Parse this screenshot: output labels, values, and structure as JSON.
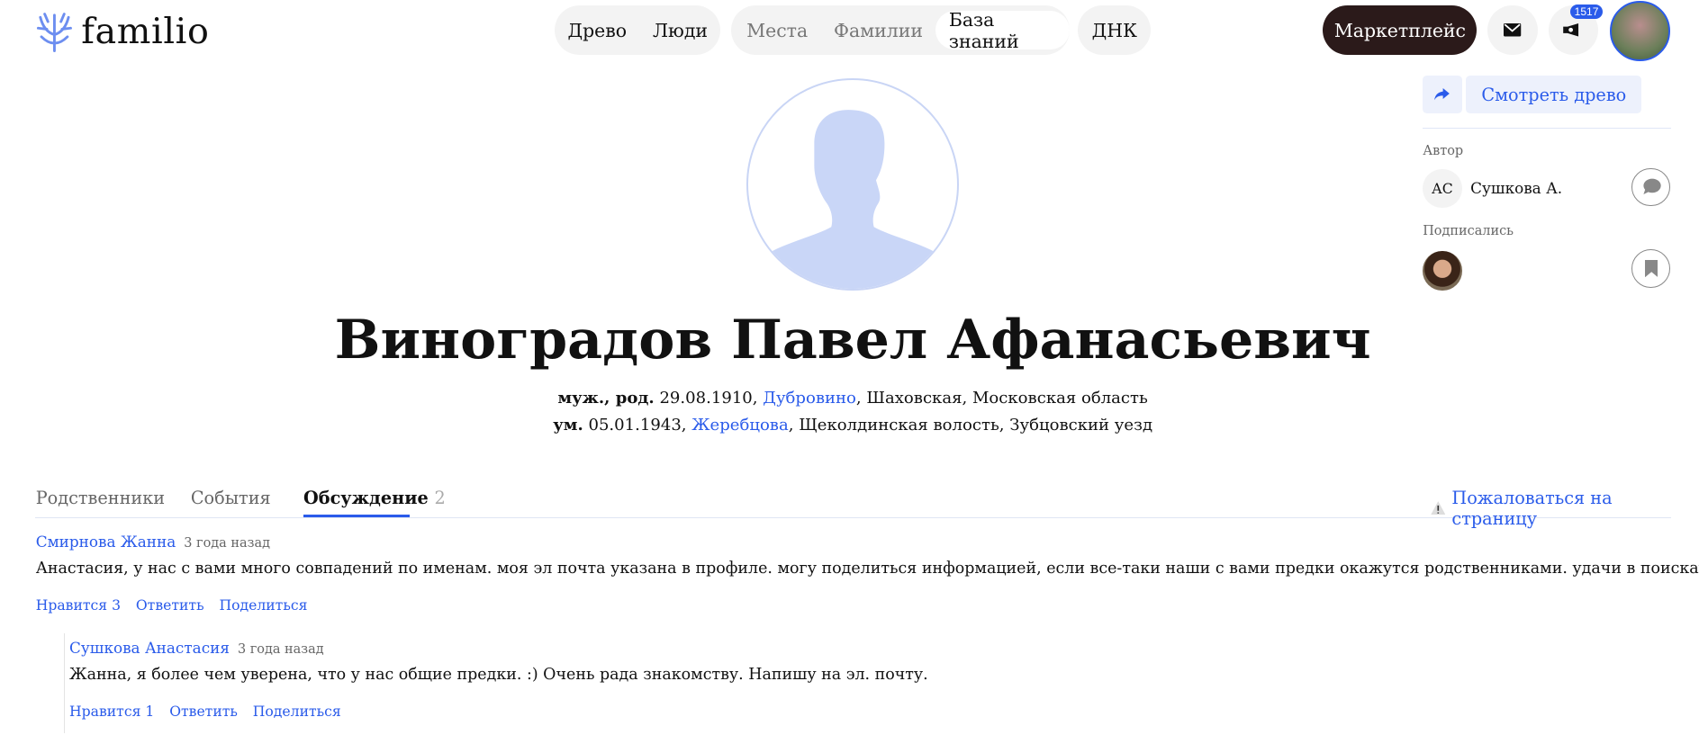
{
  "header": {
    "logo": "familio",
    "nav_group1": [
      "Древо",
      "Люди"
    ],
    "nav_group2": [
      "Места",
      "Фамилии",
      "База знаний"
    ],
    "nav_dna": "ДНК",
    "marketplace": "Маркетплейс",
    "notifications_count": "1517",
    "colors": {
      "accent": "#2a5bea",
      "marketplace_bg": "#2b1a1a"
    }
  },
  "sidebar": {
    "view_tree": "Смотреть древо",
    "author_label": "Автор",
    "author_initials": "АС",
    "author_name": "Сушкова А.",
    "subscribers_label": "Подписались"
  },
  "person": {
    "name": "Виноградов Павел Афанасьевич",
    "birth_prefix": "муж., род.",
    "birth_date": " 29.08.1910, ",
    "birth_place_link": "Дубровино",
    "birth_place_rest": ", Шаховская, Московская область",
    "death_prefix": "ум.",
    "death_date": " 05.01.1943, ",
    "death_place_link": "Жеребцова",
    "death_place_rest": ", Щеколдинская волость, Зубцовский уезд"
  },
  "tabs": [
    {
      "label": "Родственники"
    },
    {
      "label": "События"
    },
    {
      "label": "Обсуждение",
      "count": "2"
    }
  ],
  "report": "Пожаловаться на страницу",
  "comments": [
    {
      "author": "Смирнова Жанна",
      "time": "3 года назад",
      "text": "Анастасия, у нас с вами много совпадений по именам. моя эл почта указана в профиле. могу поделиться информацией, если все-таки наши с вами предки окажутся родственниками. удачи в поисках",
      "like": "Нравится 3",
      "reply": "Ответить",
      "share": "Поделиться"
    },
    {
      "author": "Сушкова Анастасия",
      "time": "3 года назад",
      "text": "Жанна, я более чем уверена, что у нас общие предки. :) Очень рада знакомству. Напишу на эл. почту.",
      "like": "Нравится 1",
      "reply": "Ответить",
      "share": "Поделиться"
    }
  ]
}
